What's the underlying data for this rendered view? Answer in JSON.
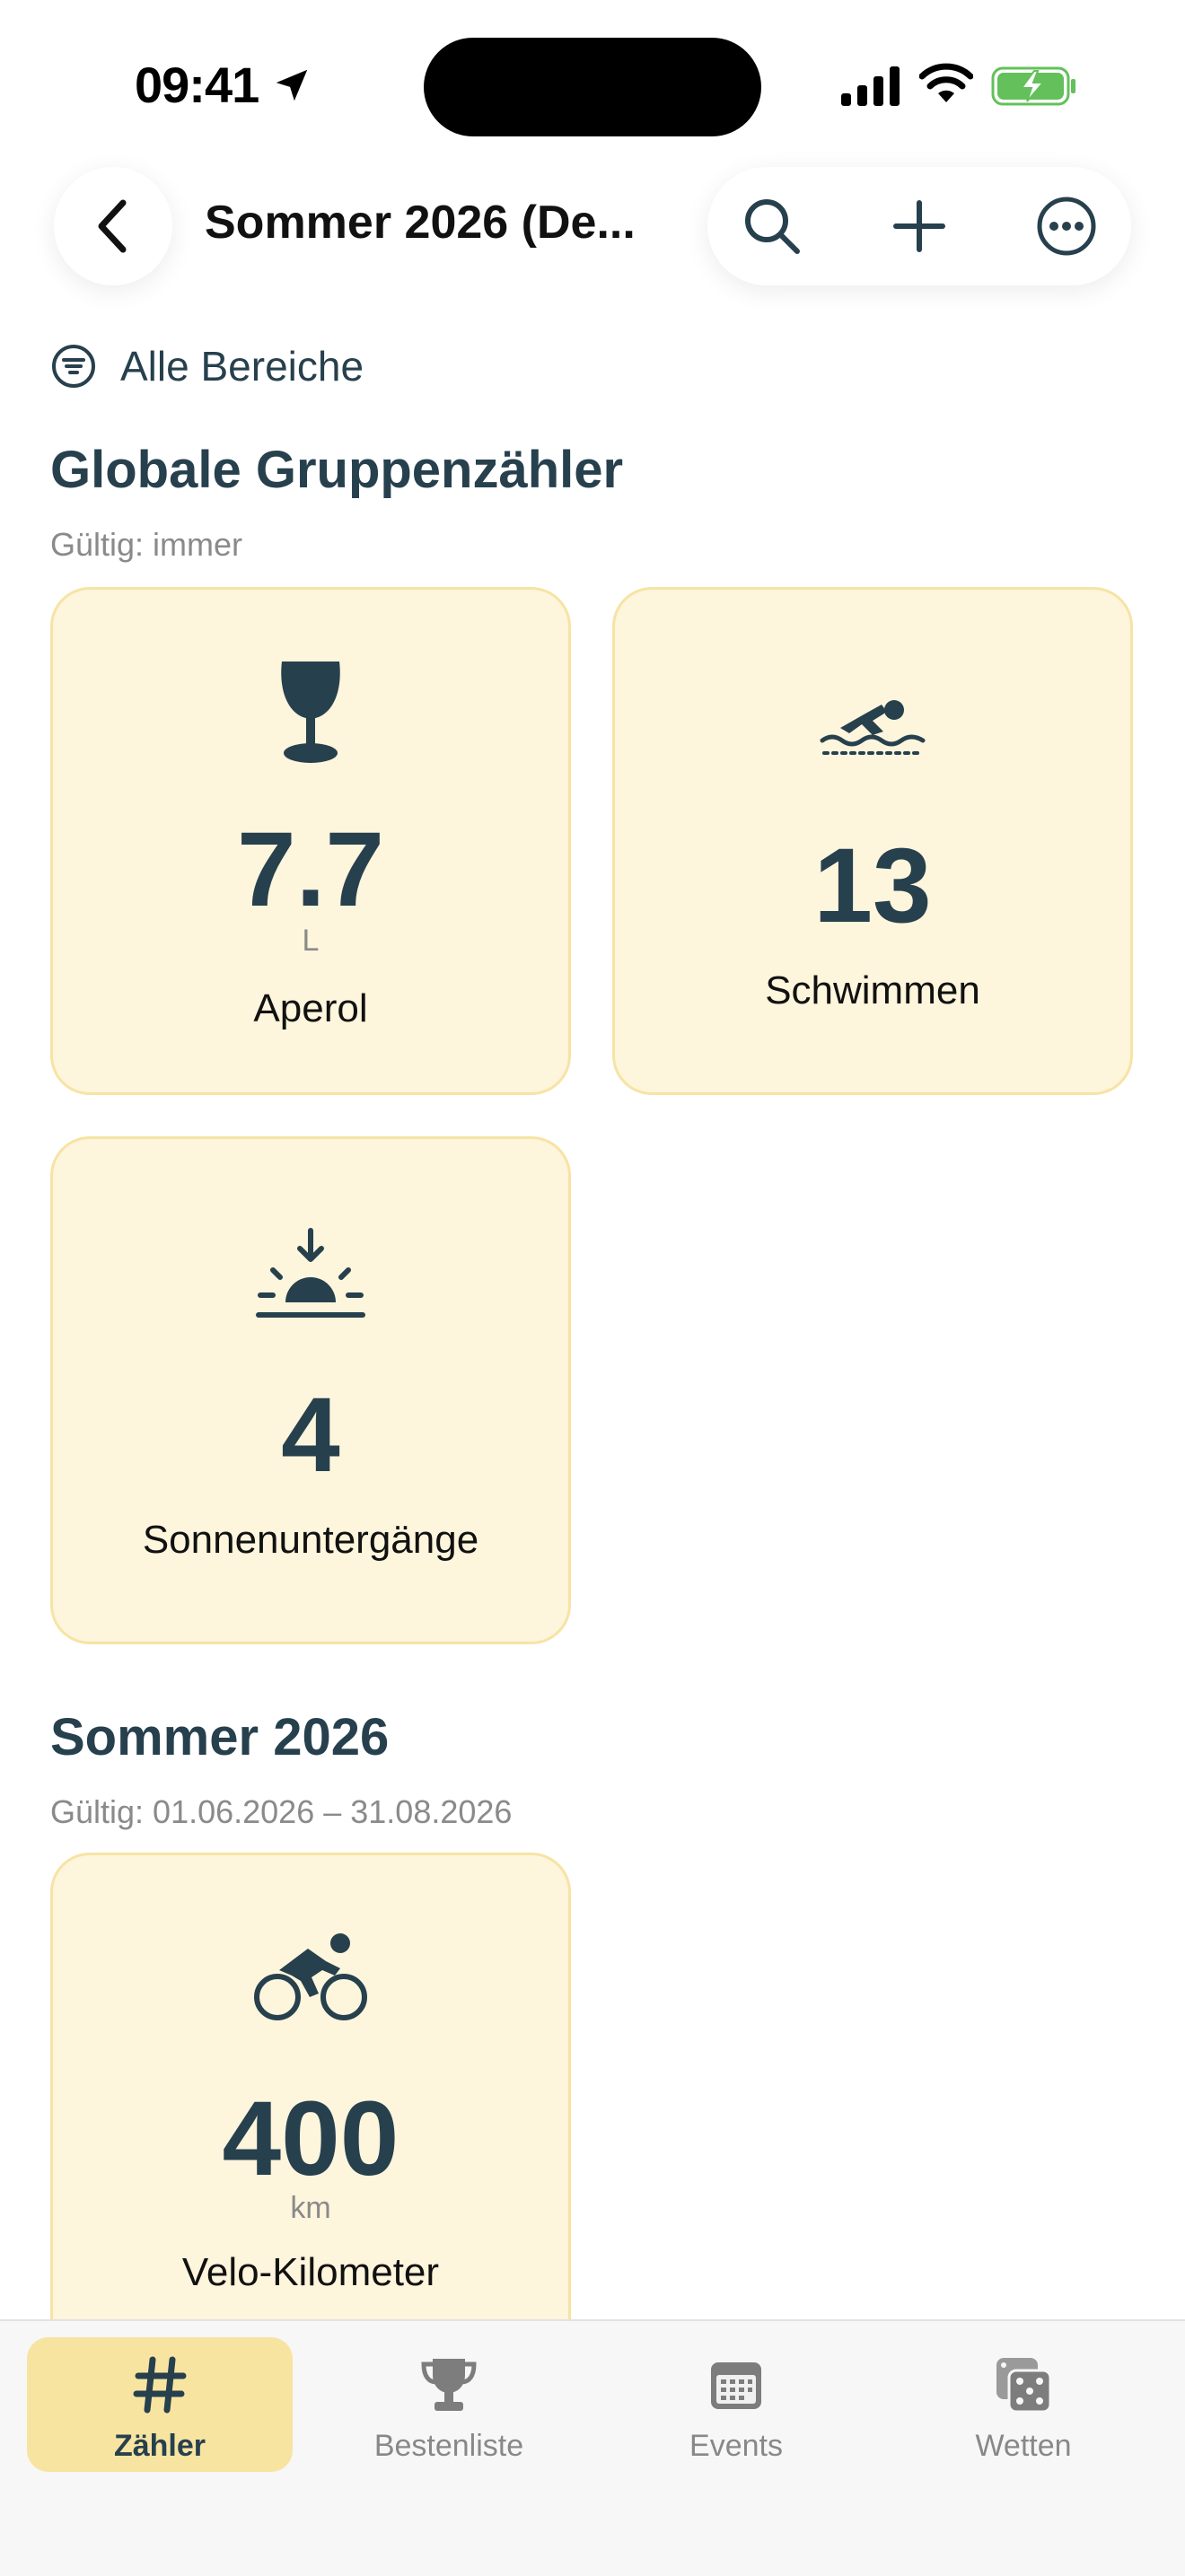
{
  "status_bar": {
    "time": "09:41"
  },
  "nav": {
    "title": "Sommer 2026 (De..."
  },
  "filter": {
    "label": "Alle Bereiche"
  },
  "sections": [
    {
      "title": "Globale Gruppenzähler",
      "subtitle": "Gültig: immer",
      "cards": [
        {
          "icon": "wine-glass-icon",
          "value": "7.7",
          "unit": "L",
          "label": "Aperol"
        },
        {
          "icon": "swimmer-icon",
          "value": "13",
          "unit": "",
          "label": "Schwimmen"
        },
        {
          "icon": "sunset-icon",
          "value": "4",
          "unit": "",
          "label": "Sonnenuntergänge"
        }
      ]
    },
    {
      "title": "Sommer 2026",
      "subtitle": "Gültig: 01.06.2026 – 31.08.2026",
      "cards": [
        {
          "icon": "cyclist-icon",
          "value": "400",
          "unit": "km",
          "label": "Velo-Kilometer"
        }
      ]
    }
  ],
  "tabs": [
    {
      "label": "Zähler",
      "icon": "hashtag-icon",
      "active": true
    },
    {
      "label": "Bestenliste",
      "icon": "trophy-icon",
      "active": false
    },
    {
      "label": "Events",
      "icon": "calendar-icon",
      "active": false
    },
    {
      "label": "Wetten",
      "icon": "dice-icon",
      "active": false
    }
  ],
  "colors": {
    "accent": "#27404d",
    "card_bg": "#fdf5dc",
    "card_border": "#f7e3a4",
    "tab_active": "#f8e4a1"
  }
}
